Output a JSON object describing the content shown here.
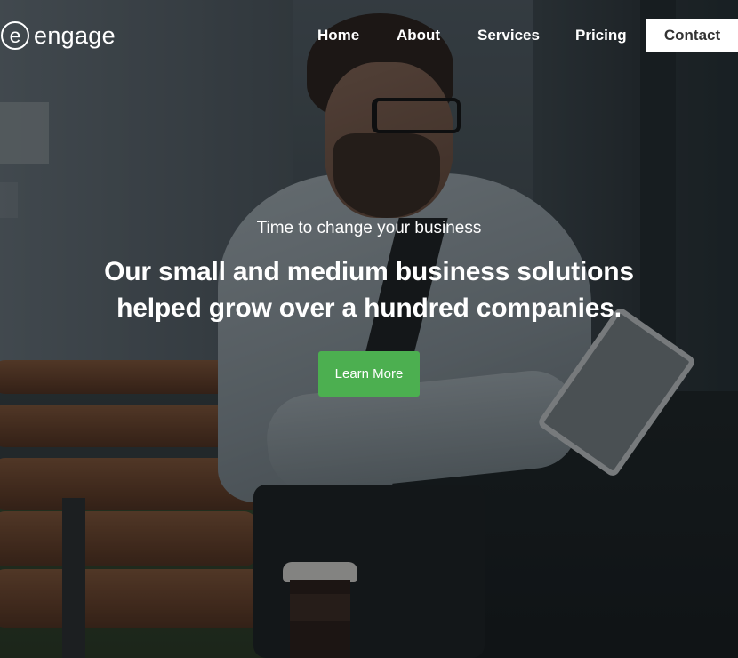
{
  "brand": {
    "logo_letter": "e",
    "name": "engage"
  },
  "nav": {
    "items": [
      {
        "label": "Home"
      },
      {
        "label": "About"
      },
      {
        "label": "Services"
      },
      {
        "label": "Pricing"
      }
    ],
    "contact_label": "Contact"
  },
  "hero": {
    "tagline": "Time to change your business",
    "headline_line1": "Our small and medium business solutions",
    "headline_line2": "helped grow over a hundred companies.",
    "cta_label": "Learn More"
  },
  "colors": {
    "accent_green": "#4caf50",
    "text_white": "#ffffff",
    "contact_bg": "#ffffff"
  },
  "icons": [
    "logo-circle-e-icon"
  ]
}
